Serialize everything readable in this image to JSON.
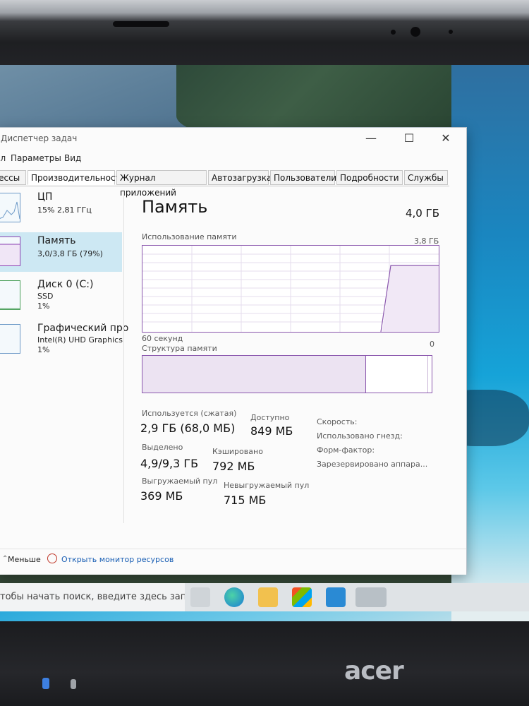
{
  "window": {
    "title": "Диспетчер задач",
    "controls": {
      "minimize": "—",
      "maximize": "☐",
      "close": "✕"
    }
  },
  "menu": [
    "Файл",
    "Параметры",
    "Вид"
  ],
  "tabs": [
    {
      "label": "Процессы",
      "active": false
    },
    {
      "label": "Производительность",
      "active": true
    },
    {
      "label": "Журнал приложений",
      "active": false
    },
    {
      "label": "Автозагрузка",
      "active": false
    },
    {
      "label": "Пользователи",
      "active": false
    },
    {
      "label": "Подробности",
      "active": false
    },
    {
      "label": "Службы",
      "active": false
    }
  ],
  "sidebar": {
    "items": [
      {
        "name": "ЦП",
        "line1": "15% 2,81 ГГц",
        "line2": ""
      },
      {
        "name": "Память",
        "line1": "3,0/3,8 ГБ (79%)",
        "line2": ""
      },
      {
        "name": "Диск 0 (C:)",
        "line1": "SSD",
        "line2": "1%"
      },
      {
        "name": "Графический про",
        "line1": "Intel(R) UHD Graphics",
        "line2": "1%"
      }
    ]
  },
  "memory": {
    "title": "Память",
    "total": "4,0 ГБ",
    "usage_label": "Использование памяти",
    "usage_max": "3,8 ГБ",
    "time_label": "60 секунд",
    "zero": "0",
    "composition_label": "Структура памяти",
    "stats": {
      "in_use_label": "Используется (сжатая)",
      "in_use_value": "2,9 ГБ (68,0 МБ)",
      "available_label": "Доступно",
      "available_value": "849 МБ",
      "committed_label": "Выделено",
      "committed_value": "4,9/9,3 ГБ",
      "cached_label": "Кэшировано",
      "cached_value": "792 МБ",
      "paged_label": "Выгружаемый пул",
      "paged_value": "369 МБ",
      "nonpaged_label": "Невыгружаемый пул",
      "nonpaged_value": "715 МБ"
    },
    "right": {
      "speed": "Скорость:",
      "slots": "Использовано гнезд:",
      "form": "Форм-фактор:",
      "reserved": "Зарезервировано аппара..."
    }
  },
  "footer": {
    "less": "Меньше",
    "open_monitor": "Открыть монитор ресурсов"
  },
  "taskbar": {
    "search_placeholder": "тобы начать поиск, введите здесь запрос"
  },
  "laptop": {
    "brand": "acer"
  },
  "colors": {
    "accent_memory": "#8a56ad",
    "selected_bg": "#cde8f3",
    "link": "#1a5fb4"
  }
}
